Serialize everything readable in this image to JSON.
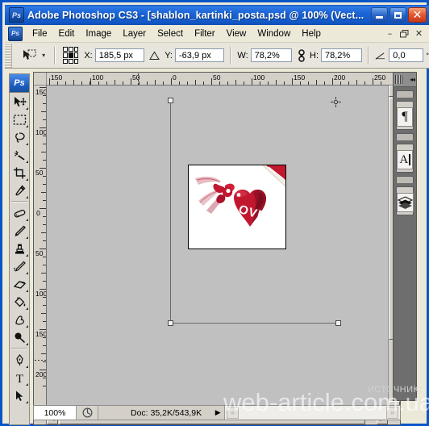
{
  "window": {
    "title": "Adobe Photoshop CS3 - [shablon_kartinki_posta.psd @ 100% (Vect...",
    "app_icon": "photoshop-icon",
    "minimize_label": "",
    "maximize_label": "",
    "close_label": "✕"
  },
  "menubar": {
    "doc_icon": "document-icon",
    "items": [
      {
        "label": "File"
      },
      {
        "label": "Edit"
      },
      {
        "label": "Image"
      },
      {
        "label": "Layer"
      },
      {
        "label": "Select"
      },
      {
        "label": "Filter"
      },
      {
        "label": "View"
      },
      {
        "label": "Window"
      },
      {
        "label": "Help"
      }
    ],
    "mdi_minimize": "–",
    "mdi_restore": "❐",
    "mdi_close": "✕"
  },
  "options_bar": {
    "tool_icon": "move-transform-icon",
    "preset_caret": "▾",
    "reference_point_label": "reference-point-grid",
    "x_label": "X:",
    "x_value": "185,5 px",
    "delta_icon": "delta-triangle-icon",
    "y_label": "Y:",
    "y_value": "-63,9 px",
    "w_label": "W:",
    "w_value": "78,2%",
    "link_icon": "link-chain-icon",
    "h_label": "H:",
    "h_value": "78,2%",
    "angle_icon": "angle-icon",
    "angle_value": "0,0",
    "degree_symbol": "°"
  },
  "toolbox": {
    "logo": "Ps",
    "tools": [
      {
        "name": "move-tool",
        "glyph": "move"
      },
      {
        "name": "marquee-tool",
        "glyph": "marquee"
      },
      {
        "name": "lasso-tool",
        "glyph": "lasso"
      },
      {
        "name": "magic-wand-tool",
        "glyph": "wand"
      },
      {
        "name": "crop-tool",
        "glyph": "crop"
      },
      {
        "name": "eyedropper-tool",
        "glyph": "eyedropper"
      },
      {
        "name": "healing-brush-tool",
        "glyph": "healing"
      },
      {
        "name": "brush-tool",
        "glyph": "brush"
      },
      {
        "name": "clone-stamp-tool",
        "glyph": "stamp"
      },
      {
        "name": "history-brush-tool",
        "glyph": "history-brush"
      },
      {
        "name": "eraser-tool",
        "glyph": "eraser"
      },
      {
        "name": "gradient-paint-bucket-tool",
        "glyph": "bucket"
      },
      {
        "name": "blur-smudge-tool",
        "glyph": "smudge"
      },
      {
        "name": "dodge-burn-tool",
        "glyph": "dodge"
      },
      {
        "name": "pen-tool",
        "glyph": "pen"
      },
      {
        "name": "type-tool",
        "glyph": "type"
      },
      {
        "name": "path-selection-tool",
        "glyph": "path-arrow"
      }
    ]
  },
  "rulers": {
    "unit": "px",
    "horizontal_labels": [
      "150",
      "100",
      "50",
      "0",
      "50",
      "100",
      "150",
      "200",
      "250"
    ],
    "vertical_labels": [
      "150",
      "100",
      "50",
      "0",
      "50",
      "100",
      "150",
      "200"
    ]
  },
  "canvas": {
    "artboard_color": "#c0c0c0",
    "image_alt": "love-heart-tag-image",
    "transform_handles": 4,
    "center_point": "transform-center-point"
  },
  "statusbar": {
    "zoom": "100%",
    "doc_icon": "document-size-icon",
    "doc_info": "Doc: 35,2K/543,9K",
    "arrow": "▶",
    "nav_prev": "«",
    "nav_next": "»"
  },
  "dock": {
    "grip": "dock-grip",
    "collapse": "◂◂",
    "panels": [
      {
        "name": "paragraph-panel-icon",
        "glyph": "¶"
      },
      {
        "name": "character-panel-icon",
        "glyph": "A"
      },
      {
        "name": "layers-panel-icon",
        "glyph": "layers"
      }
    ]
  },
  "overlay": {
    "source_label": "ИСТОЧНИК:",
    "watermark": "web-article.com.ua"
  },
  "colors": {
    "title_blue": "#1257c6",
    "chrome": "#ece9d8",
    "canvas_gray": "#c0c0c0",
    "desktop_gray": "#808080",
    "heart_red": "#c2182f"
  }
}
